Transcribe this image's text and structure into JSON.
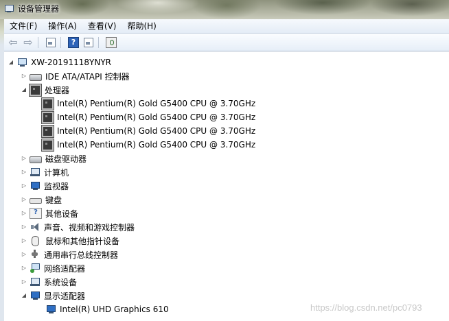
{
  "window": {
    "title": "设备管理器"
  },
  "menu": [
    {
      "label": "文件(F)"
    },
    {
      "label": "操作(A)"
    },
    {
      "label": "查看(V)"
    },
    {
      "label": "帮助(H)"
    }
  ],
  "toolbar": {
    "icons": [
      "back-arrow-icon",
      "forward-arrow-icon",
      "properties-icon",
      "help-icon",
      "update-driver-icon",
      "scan-hardware-icon"
    ]
  },
  "tree": {
    "root": {
      "label": "XW-20191118YNYR",
      "expand": "◢"
    },
    "items": [
      {
        "label": "IDE ATA/ATAPI 控制器",
        "expand": "▷"
      },
      {
        "label": "处理器",
        "expand": "◢"
      },
      {
        "label": "Intel(R) Pentium(R) Gold G5400 CPU @ 3.70GHz"
      },
      {
        "label": "Intel(R) Pentium(R) Gold G5400 CPU @ 3.70GHz"
      },
      {
        "label": "Intel(R) Pentium(R) Gold G5400 CPU @ 3.70GHz"
      },
      {
        "label": "Intel(R) Pentium(R) Gold G5400 CPU @ 3.70GHz"
      },
      {
        "label": "磁盘驱动器",
        "expand": "▷"
      },
      {
        "label": "计算机",
        "expand": "▷"
      },
      {
        "label": "监视器",
        "expand": "▷"
      },
      {
        "label": "键盘",
        "expand": "▷"
      },
      {
        "label": "其他设备",
        "expand": "▷"
      },
      {
        "label": "声音、视频和游戏控制器",
        "expand": "▷"
      },
      {
        "label": "鼠标和其他指针设备",
        "expand": "▷"
      },
      {
        "label": "通用串行总线控制器",
        "expand": "▷"
      },
      {
        "label": "网络适配器",
        "expand": "▷"
      },
      {
        "label": "系统设备",
        "expand": "▷"
      },
      {
        "label": "显示适配器",
        "expand": "◢"
      },
      {
        "label": "Intel(R) UHD Graphics 610"
      }
    ]
  },
  "watermark": "https://blog.csdn.net/pc0793",
  "colors": {
    "content_bg": "#ffffff",
    "menubar_bg": "#eaf0f8",
    "frame": "#dfe6ee"
  }
}
